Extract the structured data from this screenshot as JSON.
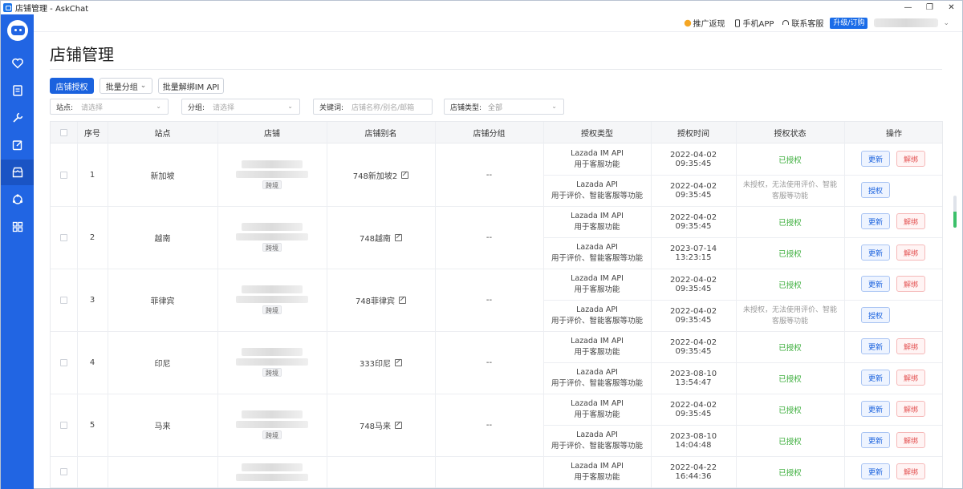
{
  "window": {
    "title": "店铺管理 - AskChat",
    "controls": [
      "—",
      "❐",
      "✕"
    ]
  },
  "topbar": {
    "promo": "推广返现",
    "mobile_app": "手机APP",
    "support": "联系客服",
    "upgrade": "升级/订购",
    "user_caret": "⌄"
  },
  "page": {
    "title": "店铺管理"
  },
  "toolbar": {
    "authorize_shop": "店铺授权",
    "batch_group": "批量分组",
    "batch_group_caret": "⌄",
    "batch_unbind_im": "批量解绑IM API"
  },
  "filters": {
    "site_label": "站点:",
    "site_placeholder": "请选择",
    "group_label": "分组:",
    "group_placeholder": "请选择",
    "keyword_label": "关键词:",
    "keyword_placeholder": "店铺名称/别名/邮箱",
    "type_label": "店铺类型:",
    "type_value": "全部"
  },
  "table": {
    "headers": [
      "序号",
      "站点",
      "店铺",
      "店铺别名",
      "店铺分组",
      "授权类型",
      "授权时间",
      "授权状态",
      "操作"
    ],
    "shops": [
      {
        "no": "1",
        "site": "新加坡",
        "tag": "跨境",
        "alias": "748新加坡2",
        "group": "--",
        "auths": [
          {
            "type1": "Lazada IM API",
            "type2": "用于客服功能",
            "time": "2022-04-02 09:35:45",
            "status": "已授权",
            "btn1": "更新",
            "btn2": "解绑"
          },
          {
            "type1": "Lazada API",
            "type2": "用于评价、智能客服等功能",
            "time": "2022-04-02 09:35:45",
            "status1": "未授权，无法使用评价、智能",
            "status2": "客服等功能",
            "btn1": "授权"
          }
        ]
      },
      {
        "no": "2",
        "site": "越南",
        "tag": "跨境",
        "alias": "748越南",
        "group": "--",
        "auths": [
          {
            "type1": "Lazada IM API",
            "type2": "用于客服功能",
            "time": "2022-04-02 09:35:45",
            "status": "已授权",
            "btn1": "更新",
            "btn2": "解绑"
          },
          {
            "type1": "Lazada API",
            "type2": "用于评价、智能客服等功能",
            "time": "2023-07-14 13:23:15",
            "status": "已授权",
            "btn1": "更新",
            "btn2": "解绑"
          }
        ]
      },
      {
        "no": "3",
        "site": "菲律宾",
        "tag": "跨境",
        "alias": "748菲律宾",
        "group": "--",
        "auths": [
          {
            "type1": "Lazada IM API",
            "type2": "用于客服功能",
            "time": "2022-04-02 09:35:45",
            "status": "已授权",
            "btn1": "更新",
            "btn2": "解绑"
          },
          {
            "type1": "Lazada API",
            "type2": "用于评价、智能客服等功能",
            "time": "2022-04-02 09:35:45",
            "status1": "未授权，无法使用评价、智能",
            "status2": "客服等功能",
            "btn1": "授权"
          }
        ]
      },
      {
        "no": "4",
        "site": "印尼",
        "tag": "跨境",
        "alias": "333印尼",
        "group": "--",
        "auths": [
          {
            "type1": "Lazada IM API",
            "type2": "用于客服功能",
            "time": "2022-04-02 09:35:45",
            "status": "已授权",
            "btn1": "更新",
            "btn2": "解绑"
          },
          {
            "type1": "Lazada API",
            "type2": "用于评价、智能客服等功能",
            "time": "2023-08-10 13:54:47",
            "status": "已授权",
            "btn1": "更新",
            "btn2": "解绑"
          }
        ]
      },
      {
        "no": "5",
        "site": "马来",
        "tag": "跨境",
        "alias": "748马来",
        "group": "--",
        "auths": [
          {
            "type1": "Lazada IM API",
            "type2": "用于客服功能",
            "time": "2022-04-02 09:35:45",
            "status": "已授权",
            "btn1": "更新",
            "btn2": "解绑"
          },
          {
            "type1": "Lazada API",
            "type2": "用于评价、智能客服等功能",
            "time": "2023-08-10 14:04:48",
            "status": "已授权",
            "btn1": "更新",
            "btn2": "解绑"
          }
        ]
      },
      {
        "no": "",
        "site": "",
        "tag": "",
        "alias": "",
        "group": "",
        "auths": [
          {
            "type1": "Lazada IM API",
            "type2": "用于客服功能",
            "time": "2022-04-22 16:44:36",
            "status": "已授权",
            "btn1": "更新",
            "btn2": "解绑"
          }
        ]
      }
    ]
  },
  "colors": {
    "sidebar": "#2165e3",
    "primary": "#1a62de",
    "success": "#3cae3c",
    "danger": "#e45555"
  }
}
